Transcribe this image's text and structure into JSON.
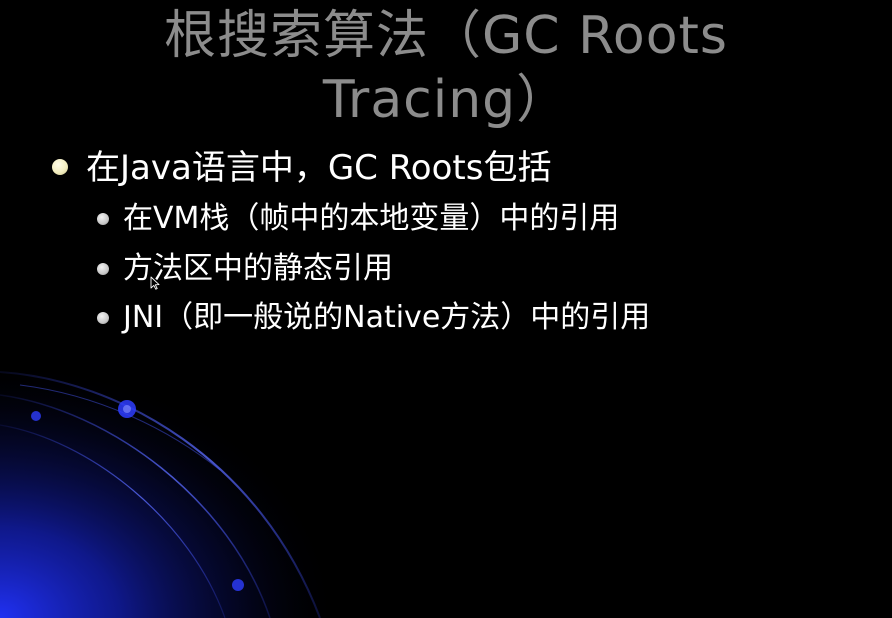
{
  "slide": {
    "title_line1": "根搜索算法（GC Roots",
    "title_line2": "Tracing）",
    "bullet_main": "在Java语言中，GC Roots包括",
    "sub_bullets": [
      "在VM栈（帧中的本地变量）中的引用",
      "方法区中的静态引用",
      "JNI（即一般说的Native方法）中的引用"
    ]
  },
  "colors": {
    "background": "#000000",
    "title": "#8c8c8c",
    "text": "#ffffff",
    "accent_blue": "#1a2bd6",
    "main_bullet": "#f3eec0",
    "sub_bullet": "#c8c8c8"
  },
  "icons": [
    "mouse-cursor-icon"
  ]
}
